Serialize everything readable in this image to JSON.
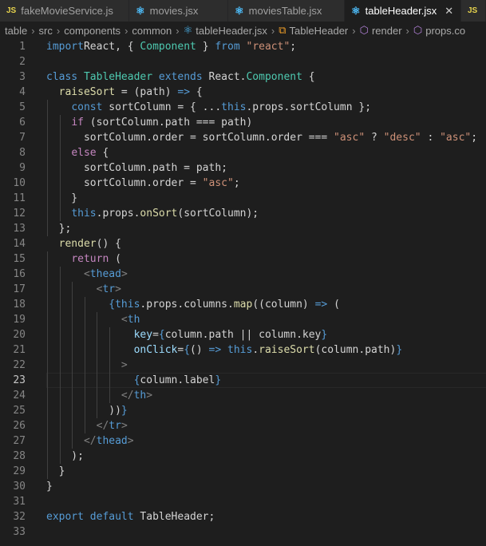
{
  "tabs": [
    {
      "icon": "JS",
      "label": "fakeMovieService.js",
      "active": false
    },
    {
      "icon": "⚛",
      "label": "movies.jsx",
      "active": false
    },
    {
      "icon": "⚛",
      "label": "moviesTable.jsx",
      "active": false
    },
    {
      "icon": "⚛",
      "label": "tableHeader.jsx",
      "active": true,
      "close": "✕"
    },
    {
      "icon": "JS",
      "label": "",
      "active": false
    }
  ],
  "breadcrumbs": [
    {
      "label": "table"
    },
    {
      "label": "src"
    },
    {
      "label": "components"
    },
    {
      "label": "common"
    },
    {
      "icon": "⚛",
      "label": "tableHeader.jsx"
    },
    {
      "icon": "⧉",
      "label": "TableHeader"
    },
    {
      "icon": "⬡",
      "label": "render"
    },
    {
      "icon": "⬡",
      "label": "props.co"
    }
  ],
  "editor": {
    "current_line": 23,
    "lines": [
      {
        "n": "1",
        "tokens": [
          [
            "kw",
            "import"
          ],
          [
            "",
            "React, { "
          ],
          [
            "cls",
            "Component"
          ],
          [
            "",
            " } "
          ],
          [
            "kw",
            "from"
          ],
          [
            "",
            " "
          ],
          [
            "str",
            "\"react\""
          ],
          [
            "",
            ";"
          ]
        ]
      },
      {
        "n": "2",
        "tokens": []
      },
      {
        "n": "3",
        "tokens": [
          [
            "kw",
            "class"
          ],
          [
            "",
            " "
          ],
          [
            "cls",
            "TableHeader"
          ],
          [
            "",
            " "
          ],
          [
            "kw",
            "extends"
          ],
          [
            "",
            " React."
          ],
          [
            "cls",
            "Component"
          ],
          [
            "",
            " {"
          ]
        ]
      },
      {
        "n": "4",
        "tokens": [
          [
            "",
            "  "
          ],
          [
            "fn",
            "raiseSort"
          ],
          [
            "",
            " = (path) "
          ],
          [
            "kw",
            "=>"
          ],
          [
            "",
            " {"
          ]
        ]
      },
      {
        "n": "5",
        "tokens": [
          [
            "",
            "    "
          ],
          [
            "kw",
            "const"
          ],
          [
            "",
            " sortColumn = { ..."
          ],
          [
            "kw",
            "this"
          ],
          [
            "",
            ".props.sortColumn };"
          ]
        ]
      },
      {
        "n": "6",
        "tokens": [
          [
            "",
            "    "
          ],
          [
            "cf",
            "if"
          ],
          [
            "",
            " (sortColumn.path === path)"
          ]
        ]
      },
      {
        "n": "7",
        "tokens": [
          [
            "",
            "      sortColumn.order = sortColumn.order === "
          ],
          [
            "str",
            "\"asc\""
          ],
          [
            "",
            " ? "
          ],
          [
            "str",
            "\"desc\""
          ],
          [
            "",
            " : "
          ],
          [
            "str",
            "\"asc\""
          ],
          [
            "",
            ";"
          ]
        ]
      },
      {
        "n": "8",
        "tokens": [
          [
            "",
            "    "
          ],
          [
            "cf",
            "else"
          ],
          [
            "",
            " {"
          ]
        ]
      },
      {
        "n": "9",
        "tokens": [
          [
            "",
            "      sortColumn.path = path;"
          ]
        ]
      },
      {
        "n": "10",
        "tokens": [
          [
            "",
            "      sortColumn.order = "
          ],
          [
            "str",
            "\"asc\""
          ],
          [
            "",
            ";"
          ]
        ]
      },
      {
        "n": "11",
        "tokens": [
          [
            "",
            "    }"
          ]
        ]
      },
      {
        "n": "12",
        "tokens": [
          [
            "",
            "    "
          ],
          [
            "kw",
            "this"
          ],
          [
            "",
            ".props."
          ],
          [
            "fn",
            "onSort"
          ],
          [
            "",
            "(sortColumn);"
          ]
        ]
      },
      {
        "n": "13",
        "tokens": [
          [
            "",
            "  };"
          ]
        ]
      },
      {
        "n": "14",
        "tokens": [
          [
            "",
            "  "
          ],
          [
            "fn",
            "render"
          ],
          [
            "",
            "() {"
          ]
        ]
      },
      {
        "n": "15",
        "tokens": [
          [
            "",
            "    "
          ],
          [
            "cf",
            "return"
          ],
          [
            "",
            " ("
          ]
        ]
      },
      {
        "n": "16",
        "tokens": [
          [
            "",
            "      "
          ],
          [
            "punct-tag",
            "<"
          ],
          [
            "tag",
            "thead"
          ],
          [
            "punct-tag",
            ">"
          ]
        ]
      },
      {
        "n": "17",
        "tokens": [
          [
            "",
            "        "
          ],
          [
            "punct-tag",
            "<"
          ],
          [
            "tag",
            "tr"
          ],
          [
            "punct-tag",
            ">"
          ]
        ]
      },
      {
        "n": "18",
        "tokens": [
          [
            "",
            "          "
          ],
          [
            "brace",
            "{"
          ],
          [
            "kw",
            "this"
          ],
          [
            "",
            ".props.columns."
          ],
          [
            "fn",
            "map"
          ],
          [
            "",
            "((column) "
          ],
          [
            "kw",
            "=>"
          ],
          [
            "",
            " ("
          ]
        ]
      },
      {
        "n": "19",
        "tokens": [
          [
            "",
            "            "
          ],
          [
            "punct-tag",
            "<"
          ],
          [
            "tag",
            "th"
          ]
        ]
      },
      {
        "n": "20",
        "tokens": [
          [
            "",
            "              "
          ],
          [
            "attr",
            "key"
          ],
          [
            "",
            "="
          ],
          [
            "brace",
            "{"
          ],
          [
            "",
            "column.path || column.key"
          ],
          [
            "brace",
            "}"
          ]
        ]
      },
      {
        "n": "21",
        "tokens": [
          [
            "",
            "              "
          ],
          [
            "attr",
            "onClick"
          ],
          [
            "",
            "="
          ],
          [
            "brace",
            "{"
          ],
          [
            "",
            "() "
          ],
          [
            "kw",
            "=>"
          ],
          [
            "",
            " "
          ],
          [
            "kw",
            "this"
          ],
          [
            "",
            "."
          ],
          [
            "fn",
            "raiseSort"
          ],
          [
            "",
            "(column.path)"
          ],
          [
            "brace",
            "}"
          ]
        ]
      },
      {
        "n": "22",
        "tokens": [
          [
            "",
            "            "
          ],
          [
            "punct-tag",
            ">"
          ]
        ]
      },
      {
        "n": "23",
        "tokens": [
          [
            "",
            "              "
          ],
          [
            "brace",
            "{"
          ],
          [
            "",
            "column.label"
          ],
          [
            "brace",
            "}"
          ]
        ]
      },
      {
        "n": "24",
        "tokens": [
          [
            "",
            "            "
          ],
          [
            "punct-tag",
            "</"
          ],
          [
            "tag",
            "th"
          ],
          [
            "punct-tag",
            ">"
          ]
        ]
      },
      {
        "n": "25",
        "tokens": [
          [
            "",
            "          ))"
          ],
          [
            "brace",
            "}"
          ]
        ]
      },
      {
        "n": "26",
        "tokens": [
          [
            "",
            "        "
          ],
          [
            "punct-tag",
            "</"
          ],
          [
            "tag",
            "tr"
          ],
          [
            "punct-tag",
            ">"
          ]
        ]
      },
      {
        "n": "27",
        "tokens": [
          [
            "",
            "      "
          ],
          [
            "punct-tag",
            "</"
          ],
          [
            "tag",
            "thead"
          ],
          [
            "punct-tag",
            ">"
          ]
        ]
      },
      {
        "n": "28",
        "tokens": [
          [
            "",
            "    );"
          ]
        ]
      },
      {
        "n": "29",
        "tokens": [
          [
            "",
            "  }"
          ]
        ]
      },
      {
        "n": "30",
        "tokens": [
          [
            "",
            "}"
          ]
        ]
      },
      {
        "n": "31",
        "tokens": []
      },
      {
        "n": "32",
        "tokens": [
          [
            "kw",
            "export"
          ],
          [
            "",
            " "
          ],
          [
            "kw",
            "default"
          ],
          [
            "",
            " TableHeader;"
          ]
        ]
      },
      {
        "n": "33",
        "tokens": []
      }
    ]
  }
}
